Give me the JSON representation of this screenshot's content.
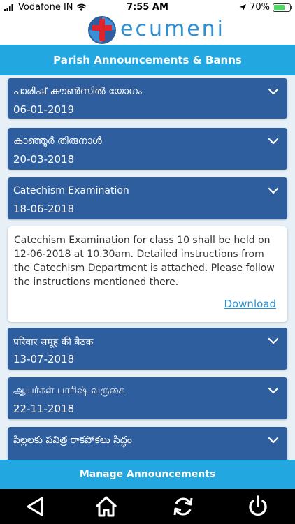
{
  "status_bar": {
    "carrier": "Vodafone IN",
    "time": "7:55 AM",
    "battery": "70%",
    "battery_level": 0.7
  },
  "brand": {
    "name": "ecumeni"
  },
  "header": {
    "title": "Parish Announcements & Banns"
  },
  "announcements": [
    {
      "title": "പാരിഷ് കൗൺസിൽ യോഗം",
      "date": "06-01-2019"
    },
    {
      "title": "കാഞ്ഞൂർ തിരുനാൾ",
      "date": "20-03-2018"
    },
    {
      "title": "Catechism Examination",
      "date": "18-06-2018"
    },
    {
      "title": "परिवार समूह की बैठक",
      "date": "13-07-2018"
    },
    {
      "title": "ஆயர்கள் பாரிஷ் வருகை",
      "date": "22-11-2018"
    },
    {
      "title": "పిల్లలకు పవిత్ర రాకపోకలు సిద్ధం",
      "date": ""
    }
  ],
  "detail": {
    "body": "Catechism Examination for class 10 shall be held on 12-06-2018 at 10.30am. Detailed instructions from the Catechism Department is attached. Please follow the instructions mentioned there.",
    "link": "Download"
  },
  "footer": {
    "manage_label": "Manage Announcements"
  },
  "colors": {
    "accent": "#22a7e0",
    "card": "#2f5e9e",
    "link": "#2a8fd0"
  }
}
